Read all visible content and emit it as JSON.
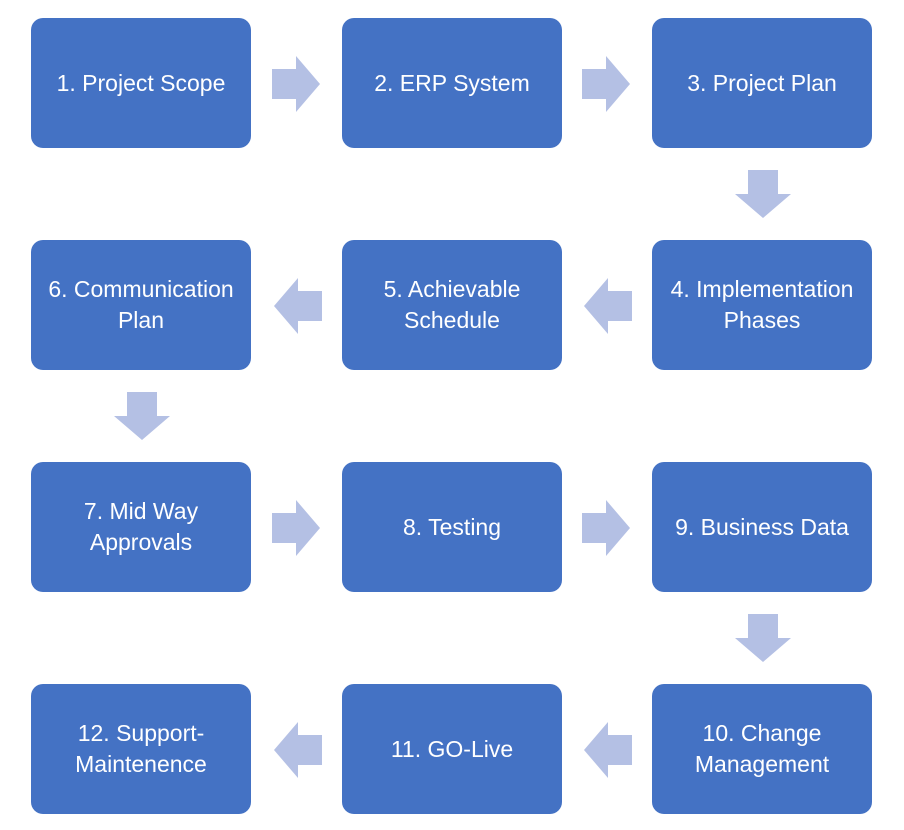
{
  "diagram": {
    "type": "process-flow",
    "box_color": "#4472c4",
    "arrow_color": "#b4c0e4",
    "steps": [
      {
        "id": 1,
        "label": "1. Project Scope"
      },
      {
        "id": 2,
        "label": "2. ERP System"
      },
      {
        "id": 3,
        "label": "3. Project Plan"
      },
      {
        "id": 4,
        "label": "4. Implementation Phases"
      },
      {
        "id": 5,
        "label": "5. Achievable Schedule"
      },
      {
        "id": 6,
        "label": "6. Communication Plan"
      },
      {
        "id": 7,
        "label": "7. Mid Way Approvals"
      },
      {
        "id": 8,
        "label": "8. Testing"
      },
      {
        "id": 9,
        "label": "9. Business Data"
      },
      {
        "id": 10,
        "label": "10. Change Management"
      },
      {
        "id": 11,
        "label": "11. GO-Live"
      },
      {
        "id": 12,
        "label": "12. Support-Maintenence"
      }
    ],
    "flow": [
      {
        "from": 1,
        "to": 2,
        "direction": "right"
      },
      {
        "from": 2,
        "to": 3,
        "direction": "right"
      },
      {
        "from": 3,
        "to": 4,
        "direction": "down"
      },
      {
        "from": 4,
        "to": 5,
        "direction": "left"
      },
      {
        "from": 5,
        "to": 6,
        "direction": "left"
      },
      {
        "from": 6,
        "to": 7,
        "direction": "down"
      },
      {
        "from": 7,
        "to": 8,
        "direction": "right"
      },
      {
        "from": 8,
        "to": 9,
        "direction": "right"
      },
      {
        "from": 9,
        "to": 10,
        "direction": "down"
      },
      {
        "from": 10,
        "to": 11,
        "direction": "left"
      },
      {
        "from": 11,
        "to": 12,
        "direction": "left"
      }
    ]
  }
}
